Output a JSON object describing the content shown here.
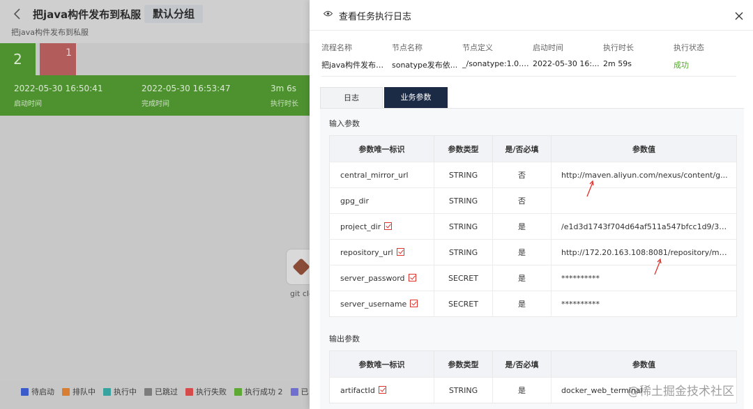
{
  "background": {
    "title": "把java构件发布到私服",
    "group_badge": "默认分组",
    "subtitle": "把java构件发布到私服",
    "run_tabs": [
      "2",
      "1"
    ],
    "stats": [
      {
        "value": "2022-05-30 16:50:41",
        "label": "启动时间"
      },
      {
        "value": "2022-05-30 16:53:47",
        "label": "完成时间"
      },
      {
        "value": "3m 6s",
        "label": "执行时长"
      }
    ],
    "node_label": "git clo",
    "legend": [
      {
        "label": "待启动",
        "color": "#3a5bc9"
      },
      {
        "label": "排队中",
        "color": "#d87e32"
      },
      {
        "label": "执行中",
        "color": "#36a3a0"
      },
      {
        "label": "已跳过",
        "color": "#7c7c7c"
      },
      {
        "label": "执行失败",
        "color": "#d64a4a"
      },
      {
        "label": "执行成功 2",
        "color": "#5ea834"
      },
      {
        "label": "已",
        "color": "#6f6fcf"
      }
    ]
  },
  "drawer": {
    "title": "查看任务执行日志",
    "summary": [
      {
        "label": "流程名称",
        "value": "把java构件发布到..."
      },
      {
        "label": "节点名称",
        "value": "sonatype发布依..."
      },
      {
        "label": "节点定义",
        "value": "_/sonatype:1.0.0..."
      },
      {
        "label": "启动时间",
        "value": "2022-05-30 16:..."
      },
      {
        "label": "执行时长",
        "value": "2m 59s"
      },
      {
        "label": "执行状态",
        "value": "成功"
      }
    ],
    "tabs": {
      "log": "日志",
      "params": "业务参数"
    },
    "input_title": "输入参数",
    "output_title": "输出参数",
    "columns": [
      "参数唯一标识",
      "参数类型",
      "是/否必填",
      "参数值"
    ],
    "input_params": [
      {
        "name": "central_mirror_url",
        "type": "STRING",
        "required": "否",
        "value": "http://maven.aliyun.com/nexus/content/g..."
      },
      {
        "name": "gpg_dir",
        "type": "STRING",
        "required": "否",
        "value": ""
      },
      {
        "name": "project_dir",
        "type": "STRING",
        "required": "是",
        "value": "/e1d3d1743f704d64af511a547bfcc1d9/30..."
      },
      {
        "name": "repository_url",
        "type": "STRING",
        "required": "是",
        "value": "http://172.20.163.108:8081/repository/ma..."
      },
      {
        "name": "server_password",
        "type": "SECRET",
        "required": "是",
        "value": "**********"
      },
      {
        "name": "server_username",
        "type": "SECRET",
        "required": "是",
        "value": "**********"
      }
    ],
    "output_params": [
      {
        "name": "artifactId",
        "type": "STRING",
        "required": "是",
        "value": "docker_web_terminal"
      }
    ]
  },
  "watermark": "@稀土掘金技术社区"
}
